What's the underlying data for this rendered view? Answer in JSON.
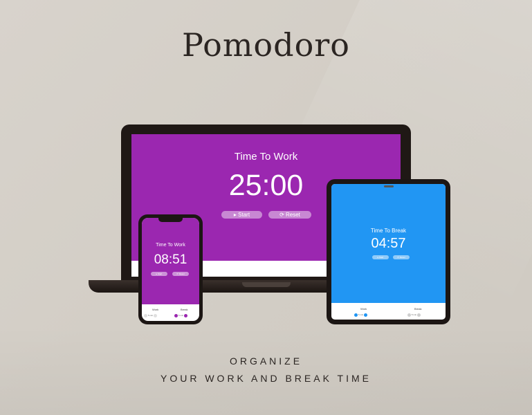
{
  "brand": {
    "title": "Pomodoro"
  },
  "tagline": {
    "line1": "ORGANIZE",
    "line2": "YOUR WORK AND BREAK TIME"
  },
  "laptop": {
    "mode_title": "Time To Work",
    "time": "25:00",
    "start_label": "▸  Start",
    "reset_label": "⟳  Reset",
    "accent": "#9b27b0"
  },
  "tablet": {
    "mode_title": "Time To Break",
    "time": "04:57",
    "start_label": "▸ Start",
    "reset_label": "⟳ Reset",
    "work_label": "Work",
    "break_label": "Break",
    "work_value": "5 min",
    "break_value": "5 min",
    "accent": "#2196f3"
  },
  "phone": {
    "mode_title": "Time To Work",
    "time": "08:51",
    "start_label": "▸ Start",
    "reset_label": "⟳ Reset",
    "work_label": "Work",
    "break_label": "Break",
    "work_value": "5 min",
    "break_value": "5 min",
    "accent": "#9b27b0"
  }
}
